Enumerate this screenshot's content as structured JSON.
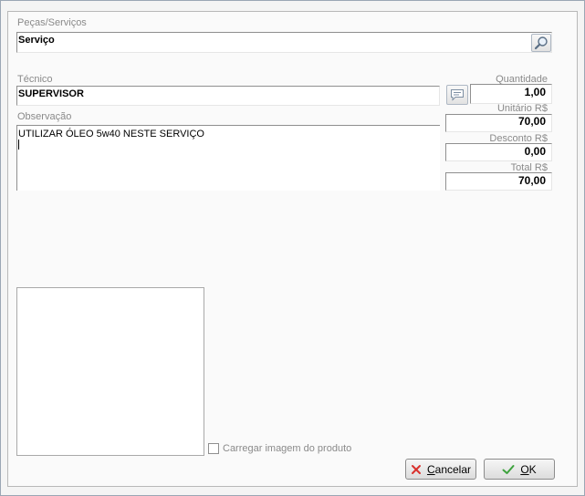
{
  "pecas": {
    "label": "Peças/Serviços",
    "value": "Serviço",
    "search_icon": "magnifier-icon"
  },
  "tecnico": {
    "label": "Técnico",
    "value": "SUPERVISOR",
    "comment_icon": "comment-icon"
  },
  "observacao": {
    "label": "Observação",
    "value": "UTILIZAR ÓLEO 5w40 NESTE SERVIÇO"
  },
  "quantidade": {
    "label": "Quantidade",
    "value": "1,00"
  },
  "unitario": {
    "label": "Unitário R$",
    "value": "70,00"
  },
  "desconto": {
    "label": "Desconto R$",
    "value": "0,00"
  },
  "total": {
    "label": "Total R$",
    "value": "70,00"
  },
  "imagem": {
    "checkbox_label": "Carregar imagem do produto",
    "checked": false
  },
  "buttons": {
    "cancel_first": "C",
    "cancel_rest": "ancelar",
    "cancel_icon": "x-icon",
    "ok_first": "O",
    "ok_rest": "K",
    "ok_icon": "check-icon"
  },
  "colors": {
    "cancel_icon": "#d9302c",
    "ok_icon": "#3da23d"
  }
}
